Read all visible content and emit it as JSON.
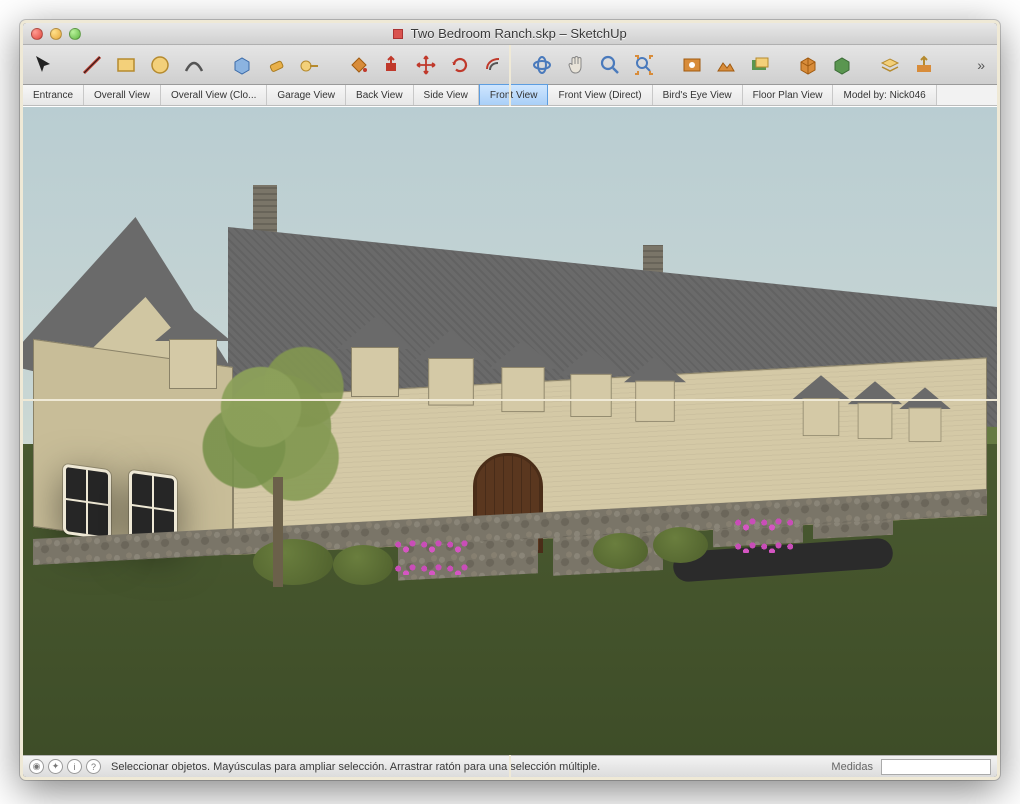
{
  "window": {
    "title": "Two Bedroom Ranch.skp – SketchUp"
  },
  "toolbar": {
    "tools": [
      "select",
      "line",
      "rectangle",
      "circle",
      "arc",
      "make-component",
      "eraser",
      "tape-measure",
      "paint-bucket",
      "push-pull",
      "move",
      "rotate",
      "offset",
      "orbit",
      "pan",
      "zoom",
      "zoom-extents",
      "add-location",
      "toggle-terrain",
      "photo-textures",
      "3d-warehouse",
      "extensions",
      "layers",
      "upload"
    ]
  },
  "scenes": {
    "tabs": [
      {
        "label": "Entrance",
        "active": false
      },
      {
        "label": "Overall View",
        "active": false
      },
      {
        "label": "Overall View (Clo...",
        "active": false
      },
      {
        "label": "Garage View",
        "active": false
      },
      {
        "label": "Back View",
        "active": false
      },
      {
        "label": "Side View",
        "active": false
      },
      {
        "label": "Front View",
        "active": true
      },
      {
        "label": "Front View (Direct)",
        "active": false
      },
      {
        "label": "Bird's Eye View",
        "active": false
      },
      {
        "label": "Floor Plan View",
        "active": false
      },
      {
        "label": "Model by: Nick046",
        "active": false
      }
    ]
  },
  "status": {
    "message": "Seleccionar objetos. Mayúsculas para ampliar selección. Arrastrar ratón para una selección múltiple.",
    "measure_label": "Medidas",
    "measure_value": ""
  }
}
